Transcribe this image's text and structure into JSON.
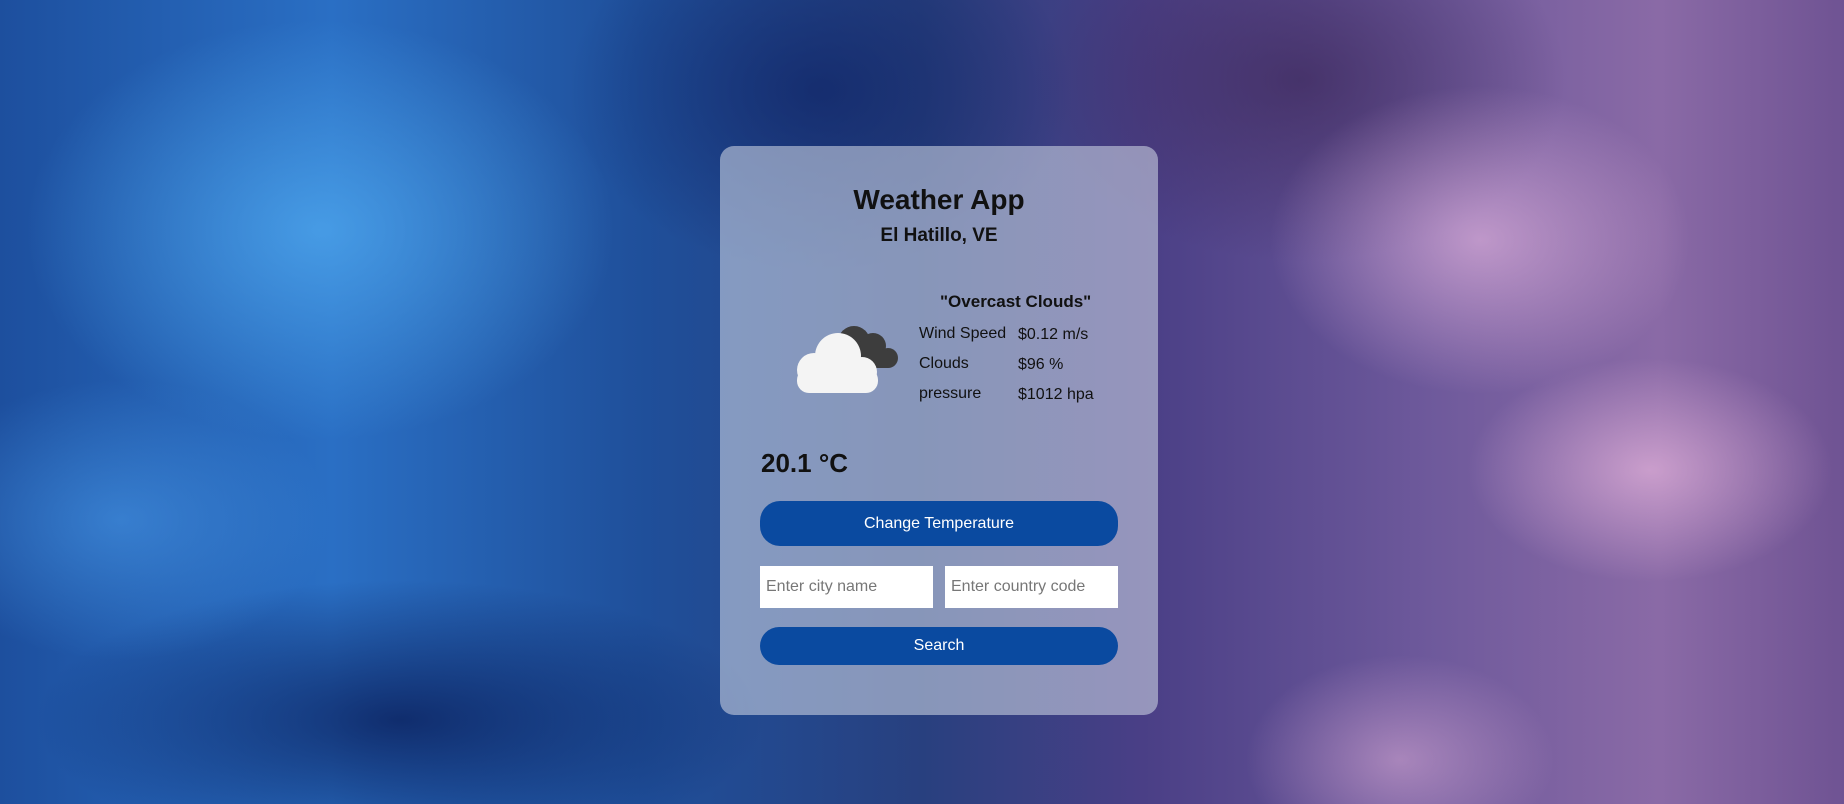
{
  "app": {
    "title": "Weather App",
    "location": "El Hatillo, VE"
  },
  "weather": {
    "description": "\"Overcast Clouds\"",
    "icon": "overcast-clouds-icon",
    "stats": [
      {
        "label": "Wind Speed",
        "value": "$0.12 m/s"
      },
      {
        "label": "Clouds",
        "value": "$96 %"
      },
      {
        "label": "pressure",
        "value": "$1012 hpa"
      }
    ],
    "temperature": "20.1 °C"
  },
  "controls": {
    "change_temperature_label": "Change Temperature",
    "city_placeholder": "Enter city name",
    "country_placeholder": "Enter country code",
    "search_label": "Search"
  },
  "colors": {
    "button": "#0a4aa0",
    "card": "rgba(205,212,228,0.58)"
  }
}
